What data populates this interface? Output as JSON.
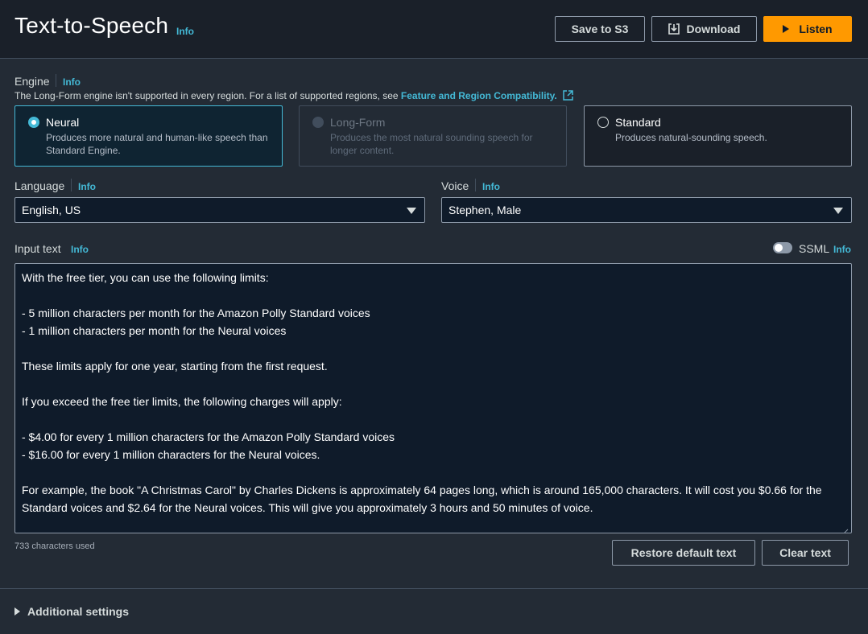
{
  "header": {
    "title": "Text-to-Speech",
    "info": "Info",
    "buttons": {
      "save_s3": "Save to S3",
      "download": "Download",
      "listen": "Listen"
    }
  },
  "engine": {
    "label": "Engine",
    "info": "Info",
    "description": "The Long-Form engine isn't supported in every region. For a list of supported regions, see",
    "link": "Feature and Region Compatibility.",
    "options": [
      {
        "title": "Neural",
        "desc": "Produces more natural and human-like speech than Standard Engine.",
        "state": "selected"
      },
      {
        "title": "Long-Form",
        "desc": "Produces the most natural sounding speech for longer content.",
        "state": "disabled"
      },
      {
        "title": "Standard",
        "desc": "Produces natural-sounding speech.",
        "state": "unselected"
      }
    ]
  },
  "language": {
    "label": "Language",
    "info": "Info",
    "value": "English, US"
  },
  "voice": {
    "label": "Voice",
    "info": "Info",
    "value": "Stephen, Male"
  },
  "input": {
    "label": "Input text",
    "info": "Info",
    "ssml_label": "SSML",
    "ssml_info": "Info",
    "ssml_enabled": false,
    "lines": [
      "With the free tier, you can use the following limits:",
      "",
      "- 5 million characters per month for the Amazon Polly Standard voices",
      "- 1 million characters per month for the Neural voices",
      "",
      "These limits apply for one year, starting from the first request.",
      "",
      "If you exceed the free tier limits, the following charges will apply:",
      "",
      "- $4.00 for every 1 million characters for the Amazon Polly Standard voices",
      "- $16.00 for every 1 million characters for the Neural voices.",
      "",
      "For example, the book \"A Christmas Carol\" by Charles Dickens is approximately 64 pages long, which is around 165,000 characters. It will cost you $0.66 for the Standard voices and $2.64 for the Neural voices. This will give you approximately 3 hours and 50 minutes of voice."
    ],
    "char_count": "733 characters used",
    "restore_label": "Restore default text",
    "clear_label": "Clear text"
  },
  "additional_settings": "Additional settings",
  "colors": {
    "accent": "#44b9d6",
    "primary_button": "#ff9900"
  }
}
